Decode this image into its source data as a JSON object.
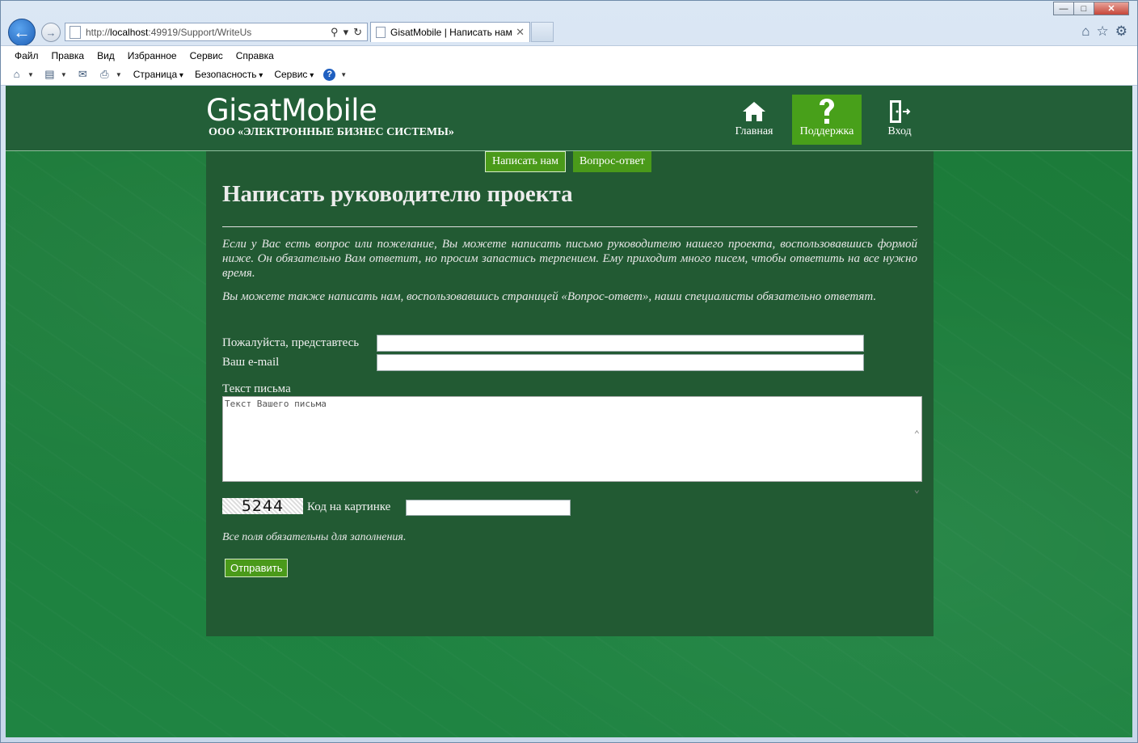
{
  "browser": {
    "url_prefix": "http://",
    "url_host": "localhost",
    "url_rest": ":49919/Support/WriteUs",
    "tab_title": "GisatMobile | Написать нам",
    "menu": [
      "Файл",
      "Правка",
      "Вид",
      "Избранное",
      "Сервис",
      "Справка"
    ],
    "cmd": [
      "Страница",
      "Безопасность",
      "Сервис"
    ]
  },
  "site": {
    "brand": "GisatMobile",
    "subtitle": "ООО «ЭЛЕКТРОННЫЕ БИЗНЕС СИСТЕМЫ»",
    "nav": [
      {
        "label": "Главная",
        "icon": "home-icon"
      },
      {
        "label": "Поддержка",
        "icon": "question-icon"
      },
      {
        "label": "Вход",
        "icon": "login-icon"
      }
    ],
    "subnav": [
      "Написать нам",
      "Вопрос-ответ"
    ]
  },
  "page": {
    "title": "Написать руководителю проекта",
    "para1": "Если у Вас есть вопрос или пожелание, Вы можете написать письмо руководителю нашего проекта, воспользовавшись формой ниже. Он обязательно Вам ответит, но просим запастись терпением. Ему приходит много писем, чтобы ответить на все нужно время.",
    "para2": "Вы можете также написать нам, воспользовавшись страницей «Вопрос-ответ», наши специалисты обязательно ответят.",
    "name_label": "Пожалуйста, представтесь",
    "email_label": "Ваш e-mail",
    "message_label": "Текст письма",
    "message_placeholder": "Текст Вашего письма",
    "captcha_value": "5244",
    "captcha_label": "Код на картинке",
    "required_note": "Все поля обязательны для заполнения.",
    "submit": "Отправить"
  }
}
